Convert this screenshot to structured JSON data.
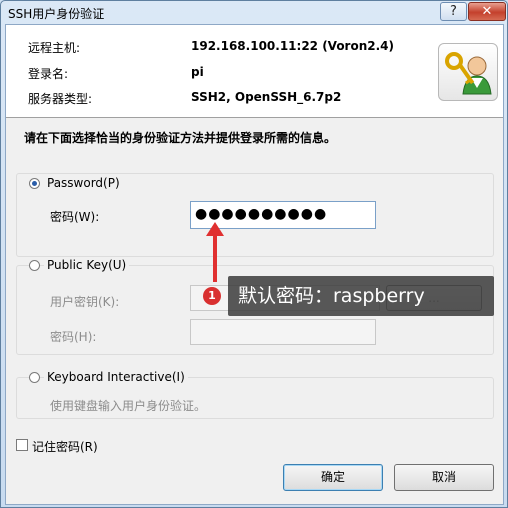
{
  "window": {
    "title": "SSH用户身份验证",
    "help_label": "?",
    "close_label": "✕"
  },
  "info": {
    "host_label": "远程主机:",
    "host_value": "192.168.100.11:22 (Voron2.4)",
    "login_label": "登录名:",
    "login_value": "pi",
    "server_type_label": "服务器类型:",
    "server_type_value": "SSH2, OpenSSH_6.7p2",
    "icon": "key-user-icon"
  },
  "instruction": "请在下面选择恰当的身份验证方法并提供登录所需的信息。",
  "password_group": {
    "radio_label": "Password(P)",
    "selected": true,
    "field_label": "密码(W):",
    "field_value": "●●●●●●●●●●"
  },
  "publickey_group": {
    "radio_label": "Public Key(U)",
    "selected": false,
    "key_label": "用户密钥(K):",
    "key_value": "",
    "browse_label": "...",
    "passphrase_label": "密码(H):"
  },
  "keyboard_group": {
    "radio_label": "Keyboard Interactive(I)",
    "selected": false,
    "description": "使用键盘输入用户身份验证。"
  },
  "remember": {
    "label": "记住密码(R)",
    "checked": false
  },
  "buttons": {
    "ok": "确定",
    "cancel": "取消"
  },
  "annotation": {
    "badge": "1",
    "text": "默认密码：raspberry",
    "color": "#e03030"
  }
}
